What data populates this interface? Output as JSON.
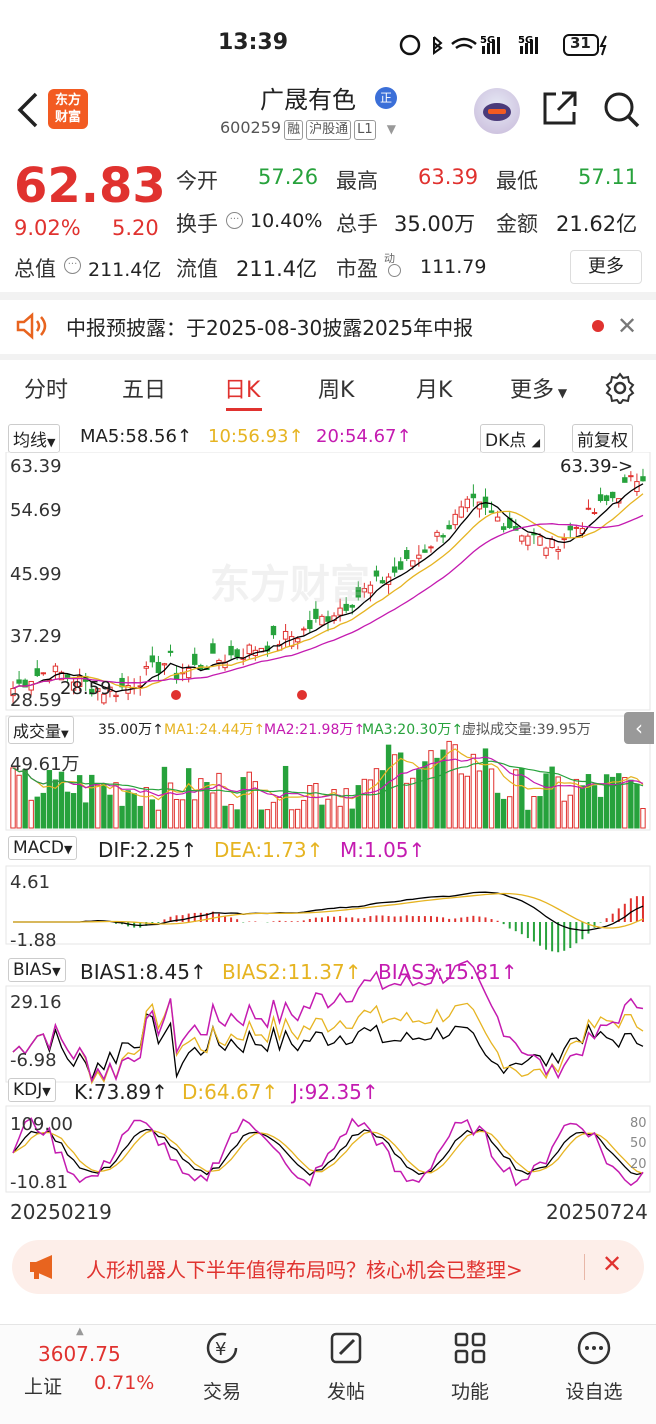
{
  "status_bar": {
    "time": "13:39",
    "battery": "31"
  },
  "header": {
    "logo_line1": "东方",
    "logo_line2": "财富",
    "stock_name": "广晟有色",
    "badge": "正",
    "code": "600259",
    "tags": [
      "融",
      "沪股通",
      "L1"
    ]
  },
  "quote": {
    "price": "62.83",
    "change_pct": "9.02%",
    "change": "5.20",
    "fields": [
      {
        "label": "今开",
        "value": "57.26",
        "color": "green"
      },
      {
        "label": "最高",
        "value": "63.39",
        "color": "red"
      },
      {
        "label": "最低",
        "value": "57.11",
        "color": "green"
      },
      {
        "label": "换手",
        "value": "10.40%",
        "color": "black"
      },
      {
        "label": "总手",
        "value": "35.00万",
        "color": "black"
      },
      {
        "label": "金额",
        "value": "21.62亿",
        "color": "black"
      },
      {
        "label": "总值",
        "value": "211.4亿",
        "color": "black"
      },
      {
        "label": "流值",
        "value": "211.4亿",
        "color": "black"
      },
      {
        "label": "市盈",
        "value": "111.79",
        "color": "black"
      }
    ],
    "pe_superscript": "动",
    "more_label": "更多"
  },
  "notice": {
    "text": "中报预披露：于2025-08-30披露2025年中报"
  },
  "tabs": [
    "分时",
    "五日",
    "日K",
    "周K",
    "月K",
    "更多"
  ],
  "active_tab": "日K",
  "kline": {
    "ma_selector": "均线",
    "ma5": "MA5:58.56",
    "ma10": "10:56.93",
    "ma20": "20:54.67",
    "dk_label": "DK点",
    "adjust_label": "前复权",
    "y_labels": [
      "63.39",
      "54.69",
      "45.99",
      "37.29",
      "28.59"
    ],
    "high_marker": "63.39->",
    "low_marker": "28.59",
    "watermark": "东方财富"
  },
  "volume": {
    "selector": "成交量",
    "value": "35.00万",
    "ma1": "MA1:24.44万",
    "ma2": "MA2:21.98万",
    "ma3": "MA3:20.30万",
    "virtual": "虚拟成交量:39.95万",
    "y_label": "49.61万"
  },
  "macd": {
    "selector": "MACD",
    "dif": "DIF:2.25",
    "dea": "DEA:1.73",
    "m": "M:1.05",
    "y_top": "4.61",
    "y_bottom": "-1.88"
  },
  "bias": {
    "selector": "BIAS",
    "b1": "BIAS1:8.45",
    "b2": "BIAS2:11.37",
    "b3": "BIAS3:15.81",
    "y_top": "29.16",
    "y_bottom": "-6.98"
  },
  "kdj": {
    "selector": "KDJ",
    "k": "K:73.89",
    "d": "D:64.67",
    "j": "J:92.35",
    "y_top": "109.00",
    "y_bottom": "-10.81",
    "r80": "80",
    "r50": "50",
    "r20": "20"
  },
  "dates": {
    "start": "20250219",
    "end": "20250724"
  },
  "ad": {
    "text": "人形机器人下半年值得布局吗？核心机会已整理>"
  },
  "bottom_nav": {
    "index_value": "3607.75",
    "index_name": "上证",
    "index_pct": "0.71%",
    "items": [
      "交易",
      "发帖",
      "功能",
      "设自选"
    ]
  },
  "colors": {
    "up": "#e0322f",
    "down": "#27a23c",
    "ma5": "#000000",
    "ma10": "#e6b422",
    "ma20": "#c41bb0"
  }
}
